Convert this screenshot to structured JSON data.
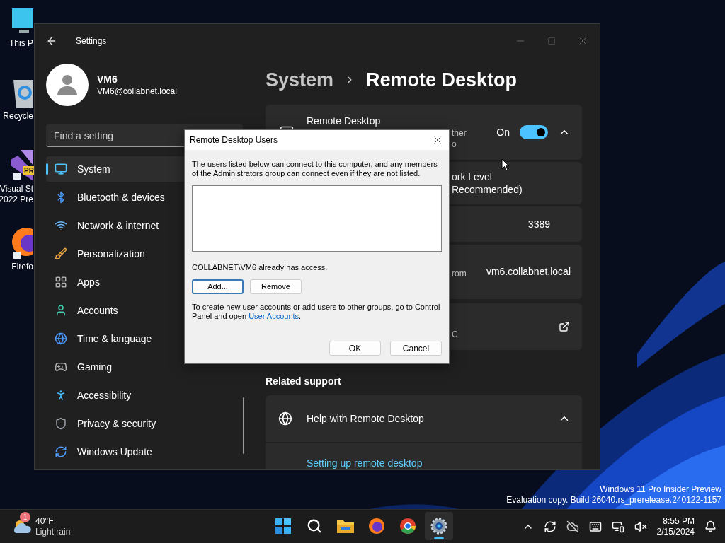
{
  "desktop": {
    "icons": [
      {
        "lines": [
          "This P"
        ]
      },
      {
        "lines": [
          "Recycle"
        ]
      },
      {
        "lines": [
          "Visual St",
          "2022 Pre"
        ],
        "badge": "PR"
      },
      {
        "lines": [
          "Firefo"
        ]
      }
    ]
  },
  "settings_window": {
    "title": "Settings",
    "user": {
      "name": "VM6",
      "email": "VM6@collabnet.local"
    },
    "search": {
      "placeholder": "Find a setting"
    },
    "nav": [
      {
        "label": "System",
        "selected": true
      },
      {
        "label": "Bluetooth & devices",
        "selected": false
      },
      {
        "label": "Network & internet",
        "selected": false
      },
      {
        "label": "Personalization",
        "selected": false
      },
      {
        "label": "Apps",
        "selected": false
      },
      {
        "label": "Accounts",
        "selected": false
      },
      {
        "label": "Time & language",
        "selected": false
      },
      {
        "label": "Gaming",
        "selected": false
      },
      {
        "label": "Accessibility",
        "selected": false
      },
      {
        "label": "Privacy & security",
        "selected": false
      },
      {
        "label": "Windows Update",
        "selected": false
      }
    ],
    "breadcrumb": {
      "parent": "System",
      "current": "Remote Desktop"
    },
    "cards": [
      {
        "kind": "toggle",
        "title": "Remote Desktop",
        "subtitle_fragments": [
          "ther",
          "o"
        ],
        "state_label": "On",
        "on": true,
        "expanded": true
      },
      {
        "kind": "text",
        "title_fragments": [
          "ork Level",
          "Recommended)"
        ]
      },
      {
        "kind": "value",
        "value": "3389"
      },
      {
        "kind": "value",
        "subtitle_fragments": [
          "rom"
        ],
        "value": "vm6.collabnet.local"
      },
      {
        "kind": "link",
        "subtitle_fragments": [
          "C"
        ]
      }
    ],
    "related_support": {
      "heading": "Related support",
      "help": {
        "title": "Help with Remote Desktop",
        "expanded": true,
        "links": [
          "Setting up remote desktop"
        ]
      }
    }
  },
  "dialog": {
    "title": "Remote Desktop Users",
    "description": "The users listed below can connect to this computer, and any members of the Administrators group can connect even if they are not listed.",
    "access_note": "COLLABNET\\VM6 already has access.",
    "list_buttons": [
      {
        "label": "Add...",
        "default": true
      },
      {
        "label": "Remove",
        "default": false
      }
    ],
    "hint": "To create new user accounts or add users to other groups, go to Control Panel and open ",
    "hint_link": "User Accounts",
    "hint_end": ".",
    "buttons": [
      {
        "label": "OK",
        "default": false
      },
      {
        "label": "Cancel",
        "default": false
      }
    ]
  },
  "os_notice": [
    "Windows 11 Pro Insider Preview",
    "Evaluation copy. Build 26040.rs_prerelease.240122-1157"
  ],
  "taskbar": {
    "weather": {
      "badge": "1",
      "temperature": "40°F",
      "condition": "Light rain"
    },
    "apps": [
      {
        "active": false
      },
      {
        "active": false
      },
      {
        "active": false
      },
      {
        "active": false
      },
      {
        "active": false
      },
      {
        "active": true
      }
    ],
    "clock": {
      "time": "8:55 PM",
      "date": "2/15/2024"
    }
  }
}
